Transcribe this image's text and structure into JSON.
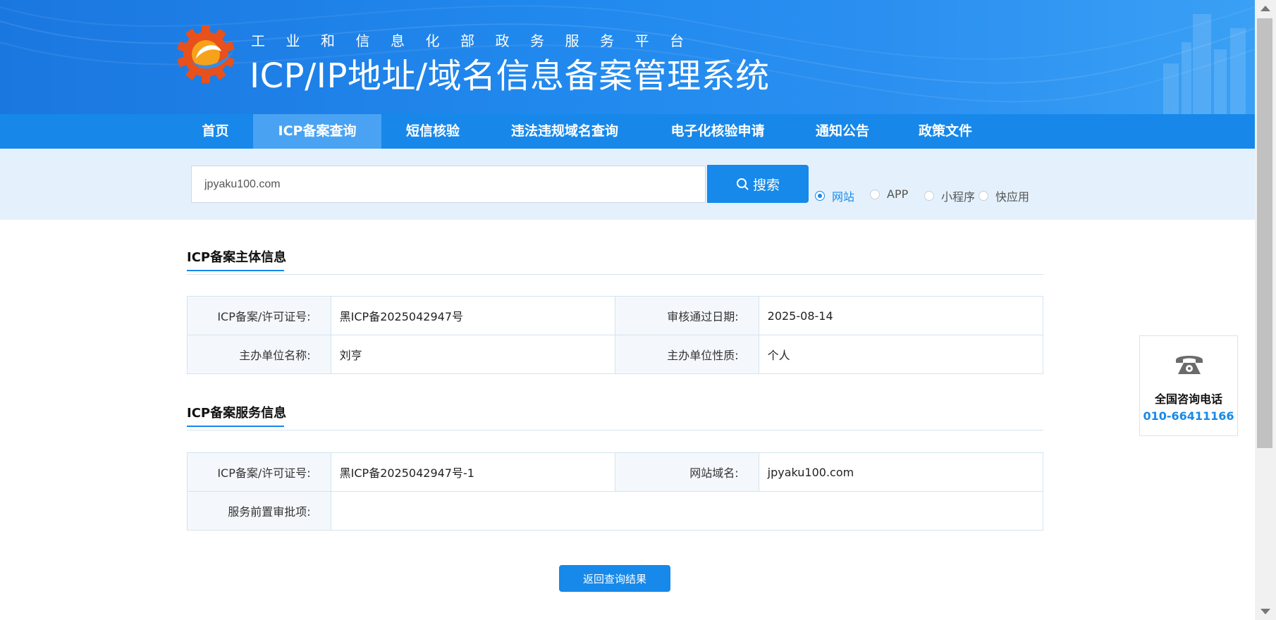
{
  "header": {
    "sub_title": "工业和信息化部政务服务平台",
    "main_title": "ICP/IP地址/域名信息备案管理系统",
    "logo_icon": "miit-gear-logo-icon"
  },
  "nav": {
    "items": [
      {
        "label": "首页",
        "active": false
      },
      {
        "label": "ICP备案查询",
        "active": true
      },
      {
        "label": "短信核验",
        "active": false
      },
      {
        "label": "违法违规域名查询",
        "active": false
      },
      {
        "label": "电子化核验申请",
        "active": false
      },
      {
        "label": "通知公告",
        "active": false
      },
      {
        "label": "政策文件",
        "active": false
      }
    ]
  },
  "search": {
    "value": "jpyaku100.com",
    "button_label": "搜索",
    "button_icon": "search-icon",
    "types": [
      {
        "label": "网站",
        "checked": true
      },
      {
        "label": "APP",
        "checked": false
      },
      {
        "label": "小程序",
        "checked": false
      },
      {
        "label": "快应用",
        "checked": false
      }
    ]
  },
  "subject_info": {
    "title": "ICP备案主体信息",
    "rows": [
      [
        {
          "label": "ICP备案/许可证号:",
          "value": "黑ICP备2025042947号"
        },
        {
          "label": "审核通过日期:",
          "value": "2025-08-14"
        }
      ],
      [
        {
          "label": "主办单位名称:",
          "value": "刘亨"
        },
        {
          "label": "主办单位性质:",
          "value": "个人"
        }
      ]
    ]
  },
  "service_info": {
    "title": "ICP备案服务信息",
    "rows": [
      [
        {
          "label": "ICP备案/许可证号:",
          "value": "黑ICP备2025042947号-1"
        },
        {
          "label": "网站域名:",
          "value": "jpyaku100.com"
        }
      ],
      [
        {
          "label": "服务前置审批项:",
          "value": ""
        }
      ]
    ]
  },
  "back_button": {
    "label": "返回查询结果"
  },
  "contact": {
    "icon": "telephone-icon",
    "label": "全国咨询电话",
    "number": "010-66411166"
  },
  "colors": {
    "accent": "#1689ea",
    "nav_bg": "#1788ea",
    "nav_active": "#49a3f2",
    "search_band": "#e4f1fd"
  }
}
